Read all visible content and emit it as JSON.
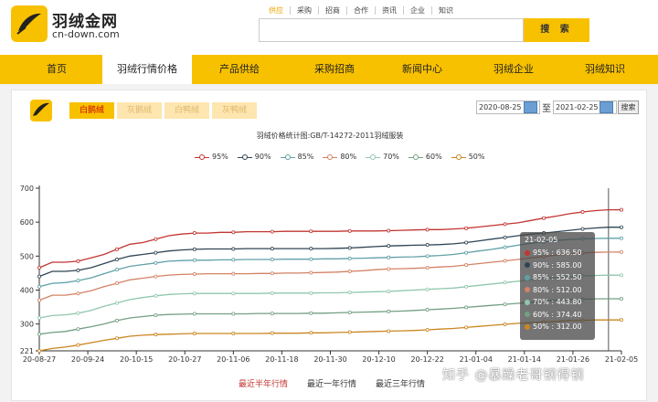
{
  "site": {
    "name": "羽绒金网",
    "domain": "cn-down.com"
  },
  "top_links": [
    "供应",
    "采购",
    "招商",
    "合作",
    "资讯",
    "企业",
    "知识"
  ],
  "search": {
    "button_label": "搜 索",
    "value": ""
  },
  "nav": [
    "首页",
    "羽绒行情价格",
    "产品供给",
    "采购招商",
    "新闻中心",
    "羽绒企业",
    "羽绒知识"
  ],
  "tabs": [
    "白鹅绒",
    "灰鹅绒",
    "白鸭绒",
    "灰鸭绒"
  ],
  "date_range": {
    "start": "2020-08-25",
    "separator": "至",
    "end": "2021-02-25",
    "query_label": "搜索"
  },
  "chart_title": "羽绒价格统计图:GB/T-14272-2011羽绒服装",
  "tooltip": {
    "date": "21-02-05",
    "rows": [
      "95% : 636.50",
      "90% : 585.00",
      "85% : 552.50",
      "80% : 512.00",
      "70% : 443.80",
      "60% : 374.40",
      "50% : 312.00"
    ]
  },
  "bottom_links": [
    "最近半年行情",
    "最近一年行情",
    "最近三年行情"
  ],
  "watermark": "知乎 @暴躁老哥钢得钢",
  "colors": {
    "brand": "#f8c100",
    "s95": "#c23531",
    "s90": "#2f4554",
    "s85": "#61a0a8",
    "s80": "#d48265",
    "s70": "#91c7ae",
    "s60": "#749f83",
    "s50": "#ca8622"
  },
  "chart_data": {
    "type": "line",
    "title": "羽绒价格统计图:GB/T-14272-2011羽绒服装",
    "xlabel": "",
    "ylabel": "",
    "ylim": [
      221,
      700
    ],
    "y_ticks": [
      221,
      300,
      400,
      500,
      600,
      700
    ],
    "x_ticks": [
      "20-08-27",
      "20-09-24",
      "20-10-15",
      "20-10-27",
      "20-11-06",
      "20-11-18",
      "20-11-30",
      "20-12-10",
      "20-12-22",
      "21-01-04",
      "21-01-14",
      "21-01-26",
      "21-02-05"
    ],
    "legend_position": "top",
    "grid": false,
    "x_points": 46,
    "series": [
      {
        "name": "95%",
        "values": [
          466,
          482,
          482,
          485,
          495,
          505,
          520,
          535,
          540,
          550,
          560,
          565,
          568,
          568,
          570,
          570,
          572,
          572,
          572,
          573,
          573,
          573,
          573,
          573,
          574,
          574,
          574,
          575,
          576,
          577,
          578,
          578,
          580,
          582,
          586,
          590,
          594,
          598,
          605,
          612,
          618,
          625,
          630,
          634,
          636.5,
          636.5
        ]
      },
      {
        "name": "90%",
        "values": [
          440,
          455,
          455,
          458,
          466,
          478,
          490,
          500,
          505,
          510,
          515,
          518,
          520,
          521,
          521,
          521,
          522,
          522,
          522,
          522,
          522,
          522,
          522,
          523,
          524,
          526,
          528,
          530,
          531,
          532,
          533,
          534,
          536,
          540,
          545,
          550,
          555,
          560,
          565,
          568,
          572,
          576,
          580,
          583,
          585,
          585
        ]
      },
      {
        "name": "85%",
        "values": [
          410,
          420,
          422,
          428,
          436,
          448,
          460,
          470,
          475,
          480,
          485,
          487,
          488,
          488,
          489,
          489,
          490,
          490,
          490,
          491,
          491,
          491,
          492,
          492,
          493,
          494,
          495,
          496,
          497,
          498,
          500,
          502,
          505,
          510,
          515,
          520,
          526,
          532,
          538,
          542,
          546,
          549,
          551,
          552,
          552.5,
          552.5
        ]
      },
      {
        "name": "80%",
        "values": [
          370,
          385,
          385,
          390,
          398,
          410,
          420,
          430,
          435,
          440,
          444,
          446,
          447,
          448,
          448,
          448,
          448,
          449,
          449,
          450,
          450,
          451,
          452,
          453,
          455,
          457,
          460,
          462,
          463,
          464,
          466,
          468,
          470,
          474,
          478,
          482,
          486,
          490,
          495,
          499,
          503,
          506,
          509,
          511,
          512,
          512
        ]
      },
      {
        "name": "70%",
        "values": [
          318,
          325,
          327,
          332,
          340,
          352,
          362,
          372,
          378,
          383,
          387,
          389,
          390,
          390,
          390,
          390,
          390,
          390,
          391,
          391,
          391,
          391,
          392,
          392,
          393,
          394,
          395,
          396,
          398,
          400,
          402,
          404,
          406,
          410,
          414,
          418,
          422,
          426,
          430,
          434,
          437,
          440,
          442,
          443,
          443.8,
          443.8
        ]
      },
      {
        "name": "60%",
        "values": [
          270,
          275,
          278,
          285,
          292,
          300,
          310,
          318,
          322,
          326,
          328,
          329,
          330,
          330,
          330,
          330,
          330,
          331,
          331,
          331,
          331,
          332,
          332,
          333,
          334,
          335,
          336,
          337,
          338,
          340,
          342,
          344,
          346,
          349,
          352,
          355,
          358,
          361,
          364,
          367,
          370,
          372,
          373,
          374,
          374.4,
          374.4
        ]
      },
      {
        "name": "50%",
        "values": [
          221,
          228,
          232,
          238,
          245,
          252,
          258,
          264,
          267,
          269,
          270,
          271,
          272,
          272,
          272,
          272,
          272,
          272,
          273,
          273,
          273,
          274,
          274,
          275,
          276,
          277,
          278,
          279,
          280,
          281,
          283,
          285,
          287,
          290,
          293,
          296,
          299,
          302,
          304,
          306,
          308,
          310,
          311,
          312,
          312,
          312
        ]
      }
    ]
  }
}
